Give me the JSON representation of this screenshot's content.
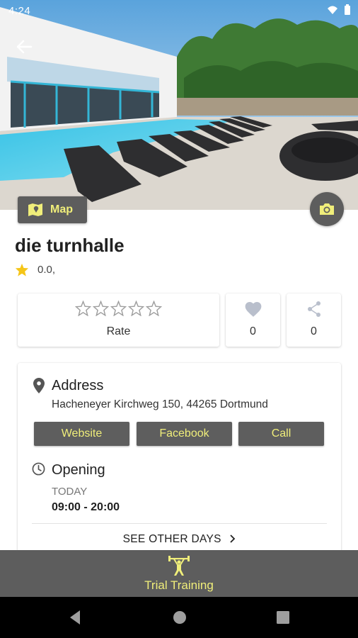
{
  "status_bar": {
    "time": "4:24"
  },
  "hero": {
    "image_desc_icon": "photo-pool",
    "map_label": "Map"
  },
  "gym": {
    "name": "die turnhalle",
    "rating": "0.0,"
  },
  "rate": {
    "label": "Rate",
    "stars_total": 5,
    "stars_filled": 0
  },
  "likes": {
    "count": "0"
  },
  "shares": {
    "count": "0"
  },
  "address": {
    "title": "Address",
    "text": "Hacheneyer Kirchweg 150, 44265  Dortmund",
    "buttons": {
      "website": "Website",
      "facebook": "Facebook",
      "call": "Call"
    }
  },
  "opening": {
    "title": "Opening",
    "today_label": "TODAY",
    "today_hours": "09:00 - 20:00",
    "see_other_days": "SEE OTHER DAYS"
  },
  "bottom": {
    "trial_label": "Trial Training"
  },
  "colors": {
    "accent": "#f0ee7a",
    "button_bg": "#5d5d5d",
    "star": "#f5c518"
  }
}
